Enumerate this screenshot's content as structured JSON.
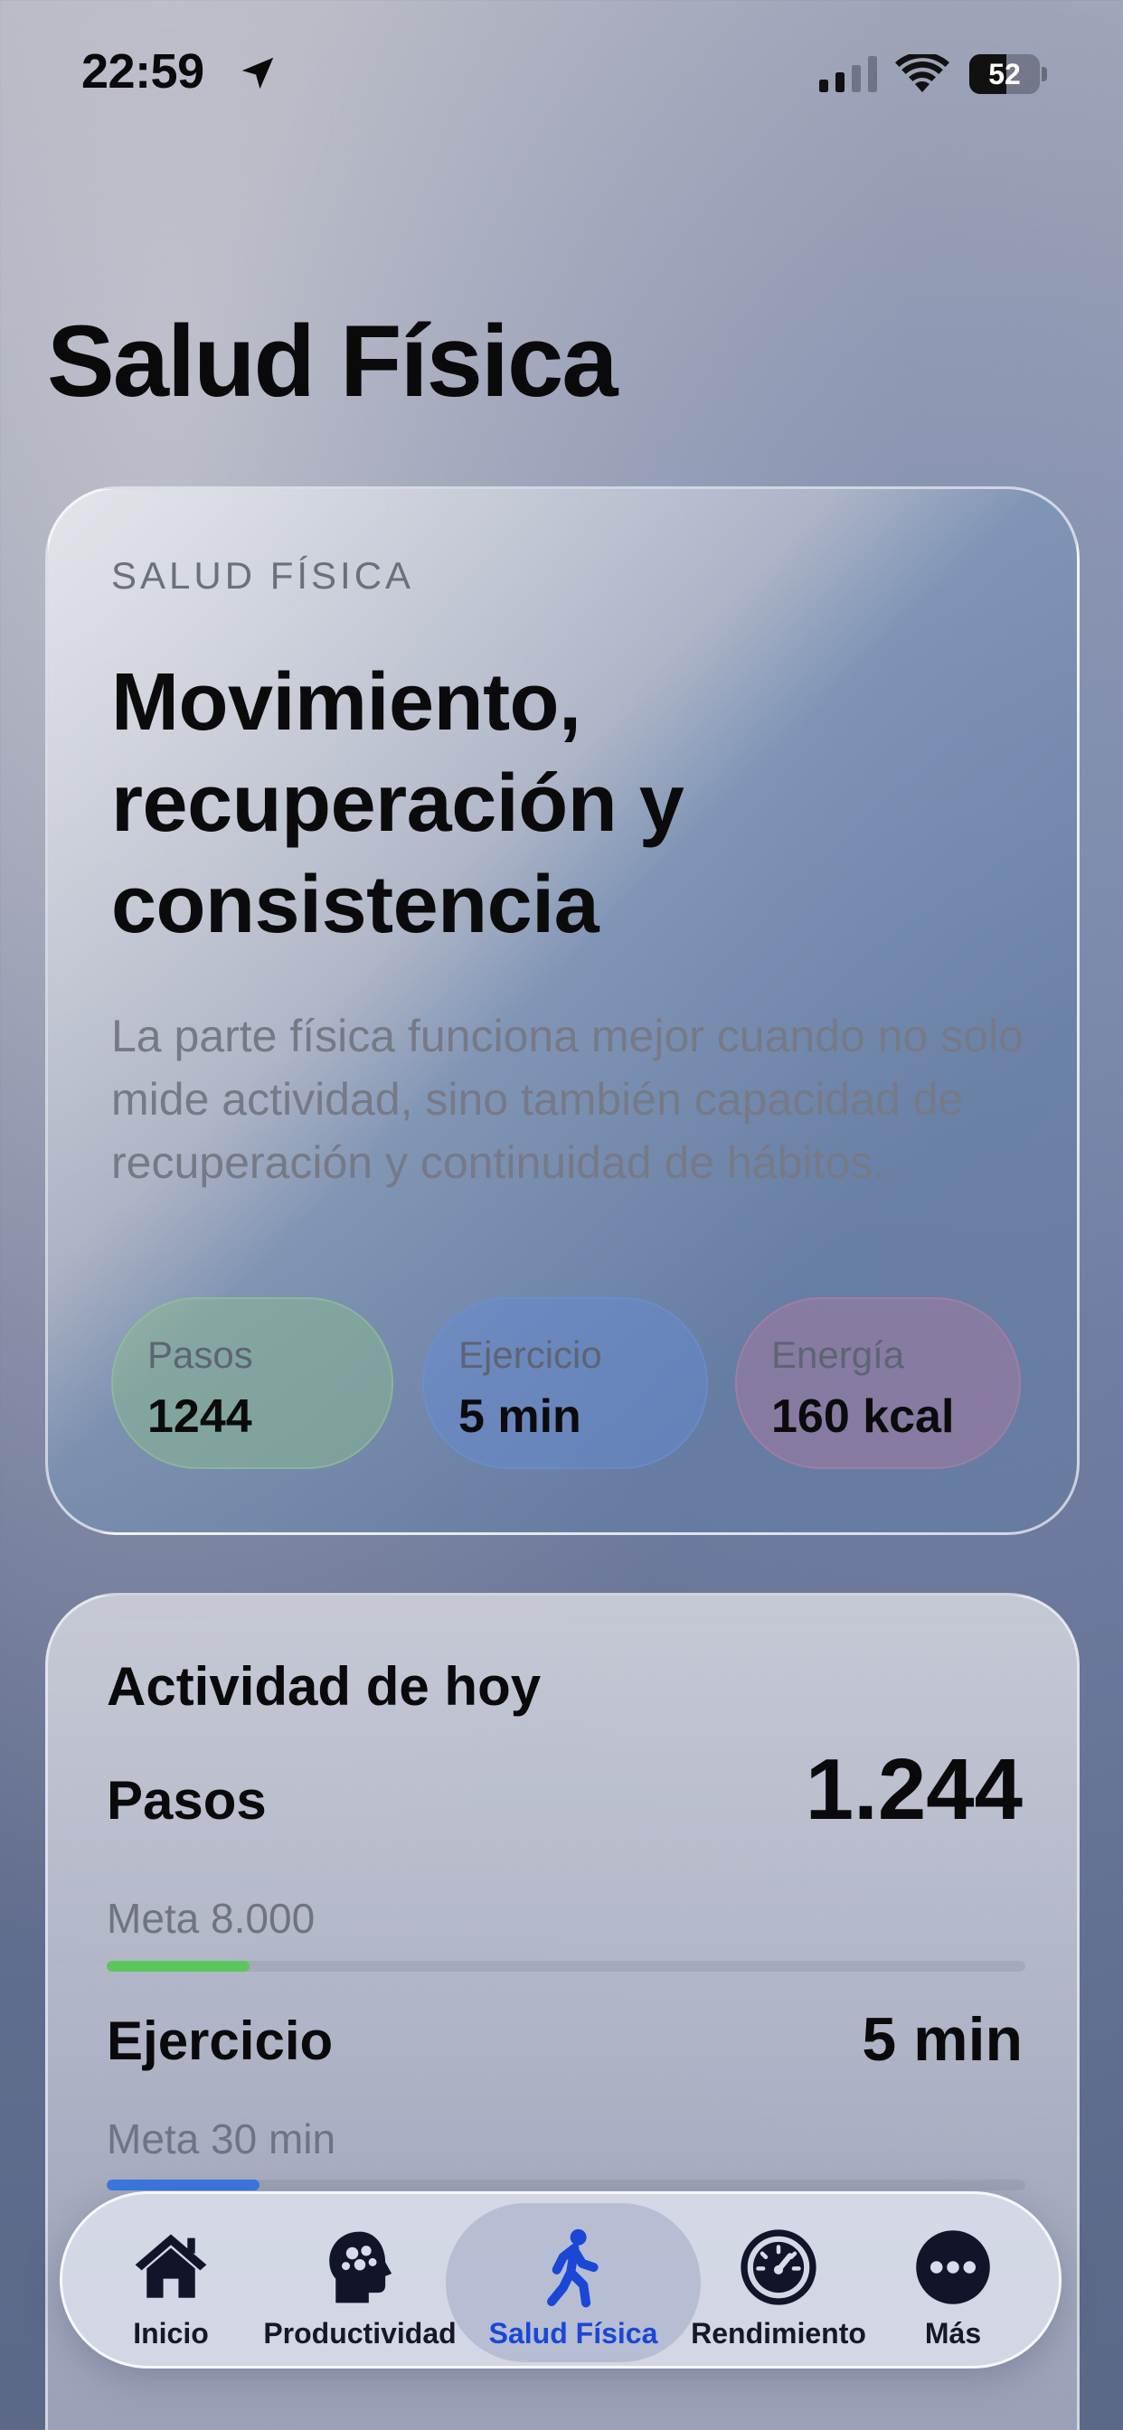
{
  "status_bar": {
    "time": "22:59",
    "battery_level": "52",
    "battery_fraction": 0.52
  },
  "page": {
    "title": "Salud Física"
  },
  "hero": {
    "eyebrow": "SALUD FÍSICA",
    "heading": "Movimiento, recuperación y consistencia",
    "description": "La parte física funciona mejor cuando no solo mide actividad, sino también capacidad de recuperación y continuidad de hábitos.",
    "pills": [
      {
        "label": "Pasos",
        "value": "1244",
        "color": "#8cbe8c"
      },
      {
        "label": "Ejercicio",
        "value": "5 min",
        "color": "#648cd7"
      },
      {
        "label": "Energía",
        "value": "160 kcal",
        "color": "#b978a0"
      }
    ]
  },
  "activity": {
    "title": "Actividad de hoy",
    "metrics": [
      {
        "label": "Pasos",
        "value": "1.244",
        "goal": "Meta 8.000",
        "progress": 0.1555,
        "color": "#5cc65c"
      },
      {
        "label": "Ejercicio",
        "value": "5 min",
        "goal": "Meta 30 min",
        "progress": 0.1667,
        "color": "#3b78e0"
      }
    ]
  },
  "tab_bar": {
    "tabs": [
      {
        "label": "Inicio",
        "icon": "house-icon",
        "active": false
      },
      {
        "label": "Productividad",
        "icon": "brain-head-icon",
        "active": false
      },
      {
        "label": "Salud Física",
        "icon": "walking-figure-icon",
        "active": true
      },
      {
        "label": "Rendimiento",
        "icon": "gauge-icon",
        "active": false
      },
      {
        "label": "Más",
        "icon": "more-dots-icon",
        "active": false
      }
    ],
    "active_color": "#1b47d6"
  }
}
